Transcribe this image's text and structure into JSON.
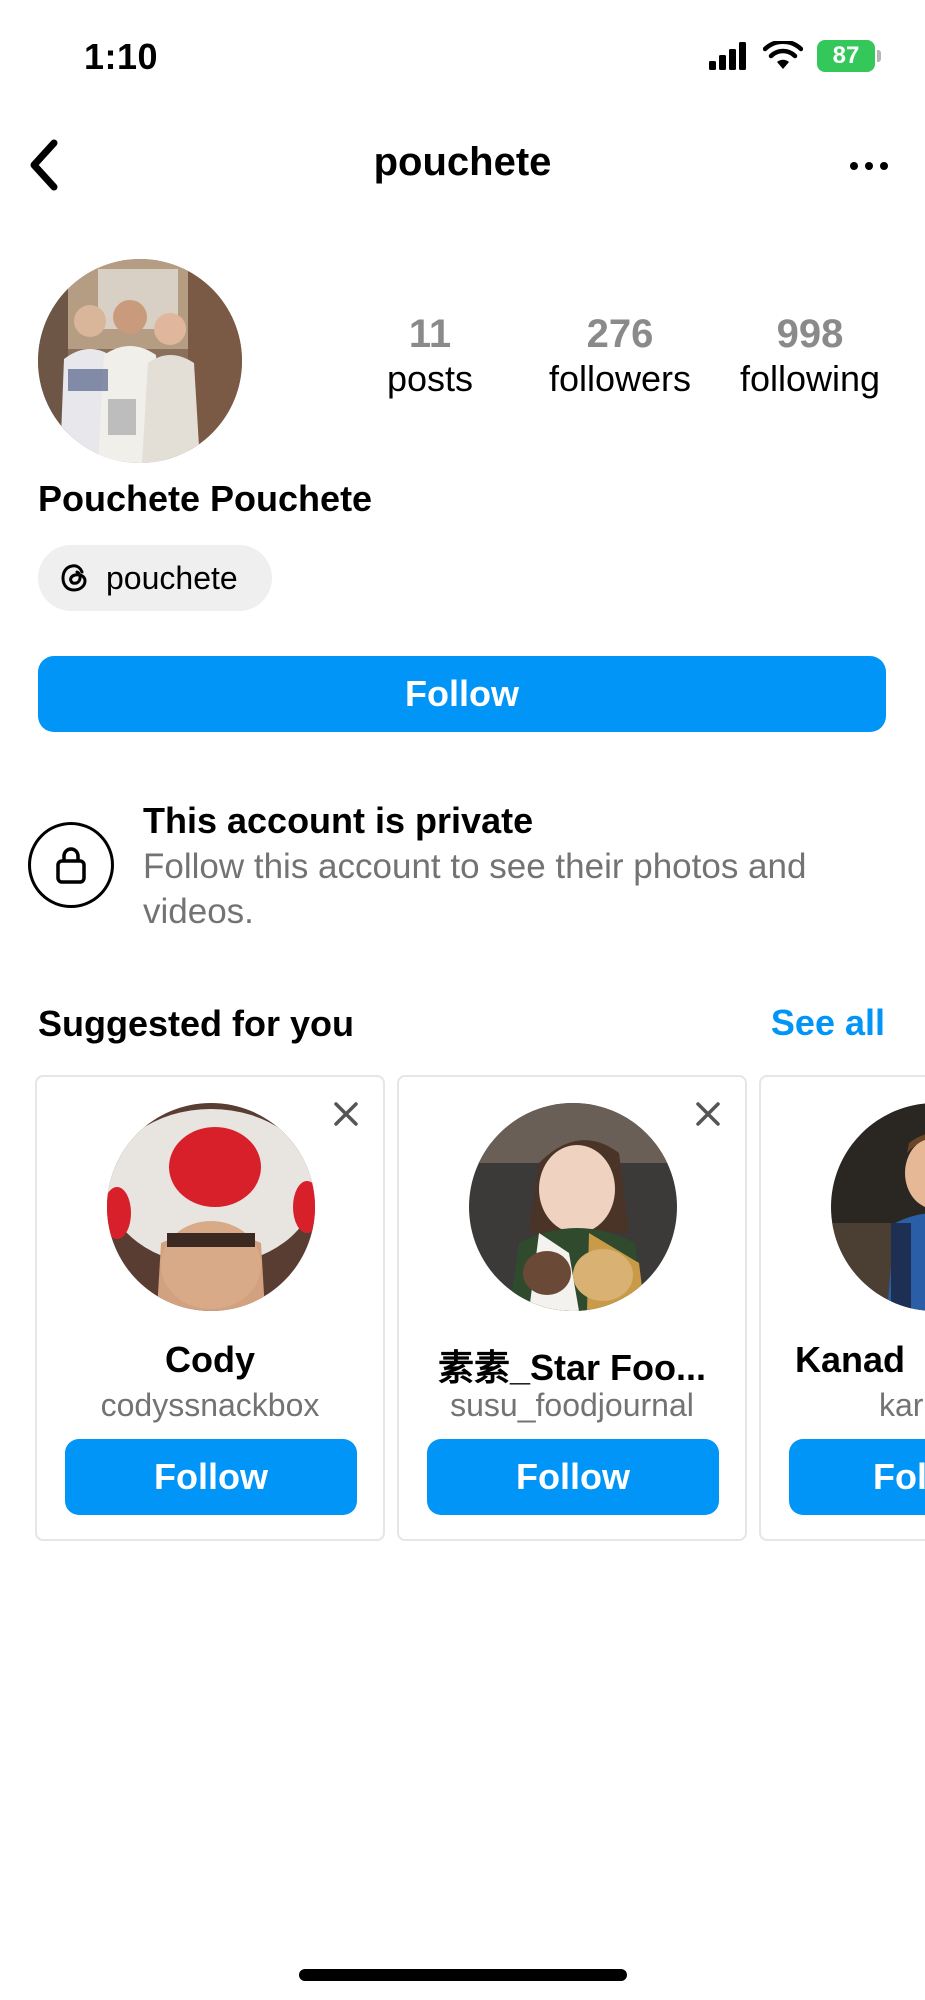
{
  "status_bar": {
    "time": "1:10",
    "battery": "87"
  },
  "header": {
    "title": "pouchete"
  },
  "profile": {
    "stats": [
      {
        "value": "11",
        "label": "posts"
      },
      {
        "value": "276",
        "label": "followers"
      },
      {
        "value": "998",
        "label": "following"
      }
    ],
    "full_name": "Pouchete Pouchete",
    "threads_handle": "pouchete",
    "follow_label": "Follow"
  },
  "private_notice": {
    "title": "This account is private",
    "description": "Follow this account to see their photos and videos."
  },
  "suggested": {
    "title": "Suggested for you",
    "see_all": "See all",
    "cards": [
      {
        "name": "Cody",
        "username": "codyssnackbox",
        "follow_label": "Follow"
      },
      {
        "name": "素素_Star Foo...",
        "username": "susu_foodjournal",
        "follow_label": "Follow"
      },
      {
        "name": "Kanad",
        "username": "kar",
        "follow_label": "Fol"
      }
    ]
  },
  "colors": {
    "accent": "#0095f6",
    "battery": "#34c759",
    "secondary_text": "#737373"
  }
}
